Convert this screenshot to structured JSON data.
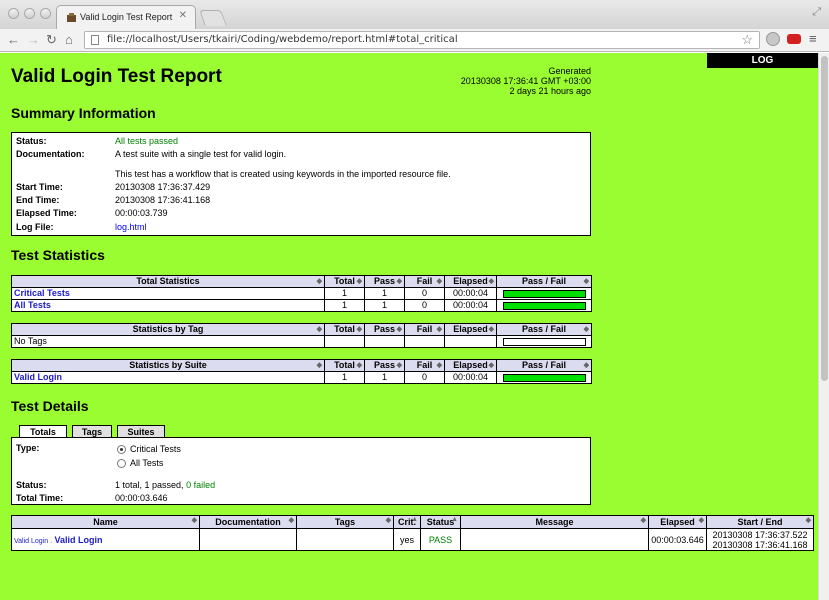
{
  "browser": {
    "tab_title": "Valid Login Test Report",
    "tab_close": "✕",
    "url": "file://localhost/Users/tkairi/Coding/webdemo/report.html#total_critical"
  },
  "colors": {
    "page_background": "#99fd32",
    "pass_bar": "#00e000",
    "header_cell": "#dcdcf0",
    "pass_text": "#008000",
    "link": "#0000ff"
  },
  "icons": [
    "back-arrow-icon",
    "forward-arrow-icon",
    "reload-icon",
    "home-icon",
    "page-icon",
    "star-icon",
    "menu-icon"
  ],
  "report": {
    "log_button": "LOG",
    "title": "Valid Login Test Report",
    "generated_label": "Generated",
    "generated_time": "20130308 17:36:41 GMT +03:00",
    "generated_ago": "2 days 21 hours ago"
  },
  "summary": {
    "heading": "Summary Information",
    "status_label": "Status:",
    "status_value": "All tests passed",
    "documentation_label": "Documentation:",
    "documentation_line1": "A test suite with a single test for valid login.",
    "documentation_line2": "This test has a workflow that is created using keywords in the imported resource file.",
    "start_label": "Start Time:",
    "start_value": "20130308 17:36:37.429",
    "end_label": "End Time:",
    "end_value": "20130308 17:36:41.168",
    "elapsed_label": "Elapsed Time:",
    "elapsed_value": "00:00:03.739",
    "logfile_label": "Log File:",
    "logfile_value": "log.html"
  },
  "statistics": {
    "heading": "Test Statistics",
    "columns": [
      "Total",
      "Pass",
      "Fail",
      "Elapsed",
      "Pass / Fail"
    ],
    "total_header": "Total Statistics",
    "total_rows": [
      {
        "name": "Critical Tests",
        "total": "1",
        "pass": "1",
        "fail": "0",
        "elapsed": "00:00:04",
        "pass_fraction": 1
      },
      {
        "name": "All Tests",
        "total": "1",
        "pass": "1",
        "fail": "0",
        "elapsed": "00:00:04",
        "pass_fraction": 1
      }
    ],
    "tag_header": "Statistics by Tag",
    "tag_rows": [
      {
        "name": "No Tags"
      }
    ],
    "suite_header": "Statistics by Suite",
    "suite_rows": [
      {
        "name": "Valid Login",
        "total": "1",
        "pass": "1",
        "fail": "0",
        "elapsed": "00:00:04",
        "pass_fraction": 1
      }
    ]
  },
  "details": {
    "heading": "Test Details",
    "tabs": [
      "Totals",
      "Tags",
      "Suites"
    ],
    "type_label": "Type:",
    "radio_critical": "Critical Tests",
    "radio_all": "All Tests",
    "status_label": "Status:",
    "status_value": "1 total, 1 passed,",
    "status_failed": "0 failed",
    "total_time_label": "Total Time:",
    "total_time_value": "00:00:03.646",
    "columns": [
      "Name",
      "Documentation",
      "Tags",
      "Crit.",
      "Status",
      "Message",
      "Elapsed",
      "Start / End"
    ],
    "row": {
      "parent": "Valid Login .",
      "name": "Valid Login",
      "documentation": "",
      "tags": "",
      "crit": "yes",
      "status": "PASS",
      "message": "",
      "elapsed": "00:00:03.646",
      "start": "20130308 17:36:37.522",
      "end": "20130308 17:36:41.168"
    }
  }
}
